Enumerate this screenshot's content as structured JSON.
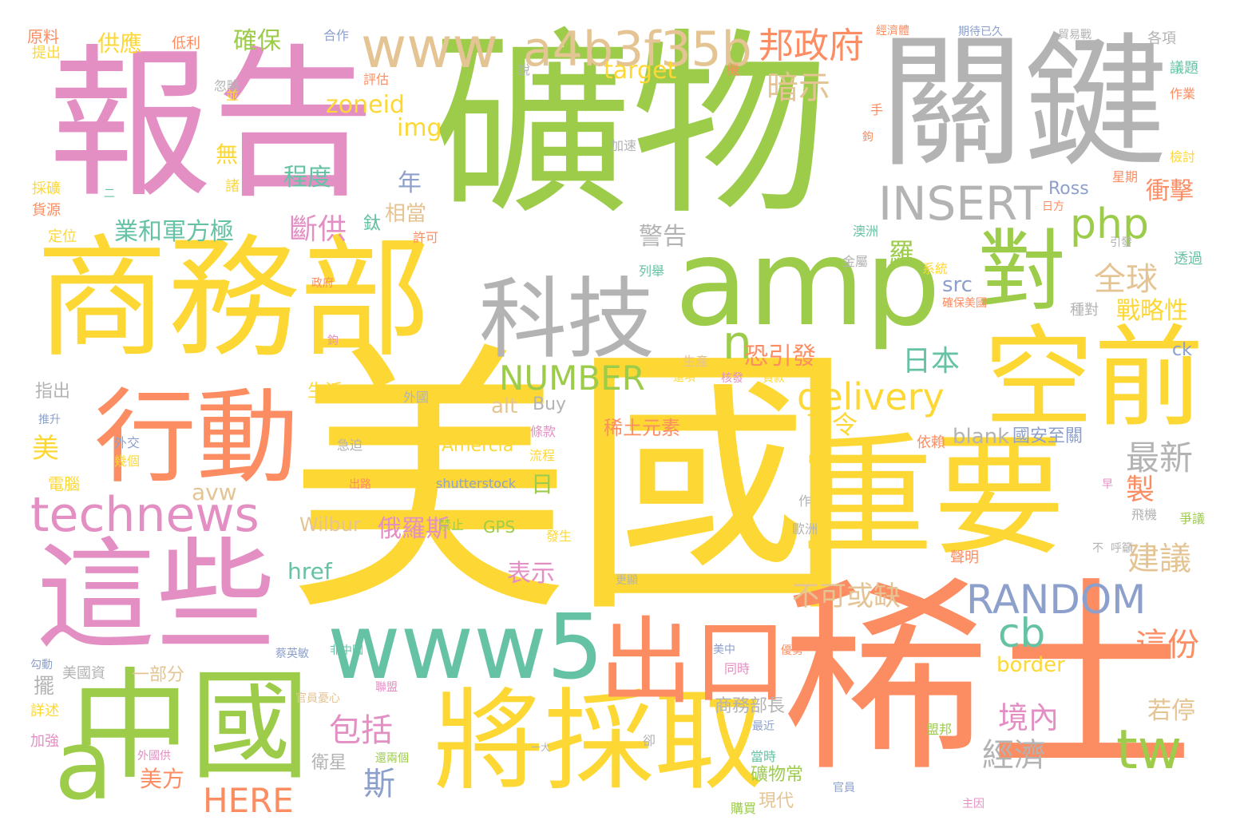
{
  "palette": {
    "yellow": "#fdd835",
    "green": "#9ccc4a",
    "pink": "#e48fc4",
    "gray": "#b3b3b3",
    "orange": "#fc8d62",
    "teal": "#66c2a5",
    "blue": "#8da0cb",
    "tan": "#e5c494"
  },
  "words": [
    {
      "text": "美國",
      "color": "yellow"
    },
    {
      "text": "礦物",
      "color": "green"
    },
    {
      "text": "稀土",
      "color": "orange"
    },
    {
      "text": "報告",
      "color": "pink"
    },
    {
      "text": "關鍵",
      "color": "gray"
    },
    {
      "text": "商務部",
      "color": "yellow"
    },
    {
      "text": "重要",
      "color": "yellow"
    },
    {
      "text": "amp",
      "color": "green"
    },
    {
      "text": "行動",
      "color": "orange"
    },
    {
      "text": "這些",
      "color": "pink"
    },
    {
      "text": "中國",
      "color": "green"
    },
    {
      "text": "將採取",
      "color": "yellow"
    },
    {
      "text": "空前",
      "color": "yellow"
    },
    {
      "text": "科技",
      "color": "gray"
    },
    {
      "text": "www5",
      "color": "teal"
    },
    {
      "text": "出口",
      "color": "orange"
    },
    {
      "text": "對",
      "color": "green"
    },
    {
      "text": "www",
      "color": "tan"
    },
    {
      "text": "a4b3f35b",
      "color": "tan"
    },
    {
      "text": "technews",
      "color": "pink"
    },
    {
      "text": "a",
      "color": "green"
    },
    {
      "text": "INSERT",
      "color": "gray"
    },
    {
      "text": "RANDOM",
      "color": "blue"
    },
    {
      "text": "delivery",
      "color": "yellow"
    },
    {
      "text": "php",
      "color": "green"
    },
    {
      "text": "tw",
      "color": "green"
    },
    {
      "text": "NUMBER",
      "color": "green"
    },
    {
      "text": "邦政府",
      "color": "orange"
    },
    {
      "text": "cb",
      "color": "teal"
    },
    {
      "text": "HERE",
      "color": "orange"
    },
    {
      "text": "n",
      "color": "green"
    },
    {
      "text": "暗示",
      "color": "tan"
    },
    {
      "text": "全球",
      "color": "tan"
    },
    {
      "text": "最新",
      "color": "gray"
    },
    {
      "text": "建議",
      "color": "tan"
    },
    {
      "text": "這份",
      "color": "orange"
    },
    {
      "text": "包括",
      "color": "pink"
    },
    {
      "text": "經濟",
      "color": "gray"
    },
    {
      "text": "境內",
      "color": "pink"
    },
    {
      "text": "不可或缺",
      "color": "tan"
    },
    {
      "text": "日本",
      "color": "teal"
    },
    {
      "text": "斷供",
      "color": "pink"
    },
    {
      "text": "業和軍方極",
      "color": "teal"
    },
    {
      "text": "zoneid",
      "color": "yellow"
    },
    {
      "text": "target",
      "color": "yellow"
    },
    {
      "text": "img",
      "color": "yellow"
    },
    {
      "text": "程度",
      "color": "teal"
    },
    {
      "text": "確保",
      "color": "green"
    },
    {
      "text": "戰略性",
      "color": "yellow"
    },
    {
      "text": "恐引發",
      "color": "orange"
    },
    {
      "text": "警告",
      "color": "gray"
    },
    {
      "text": "衝擊",
      "color": "orange"
    },
    {
      "text": "供應",
      "color": "yellow"
    },
    {
      "text": "年",
      "color": "blue"
    },
    {
      "text": "相當",
      "color": "tan"
    },
    {
      "text": "羅",
      "color": "green"
    },
    {
      "text": "src",
      "color": "blue"
    },
    {
      "text": "俄羅斯",
      "color": "pink"
    },
    {
      "text": "表示",
      "color": "pink"
    },
    {
      "text": "blank",
      "color": "gray"
    },
    {
      "text": "國安至關",
      "color": "blue"
    },
    {
      "text": "border",
      "color": "yellow"
    },
    {
      "text": "avw",
      "color": "tan"
    },
    {
      "text": "Wilbur",
      "color": "tan"
    },
    {
      "text": "href",
      "color": "teal"
    },
    {
      "text": "alt",
      "color": "tan"
    },
    {
      "text": "Buy",
      "color": "gray"
    },
    {
      "text": "稀土元素",
      "color": "orange"
    },
    {
      "text": "Amercia",
      "color": "yellow"
    },
    {
      "text": "shutterstock",
      "color": "blue"
    },
    {
      "text": "GPS",
      "color": "green"
    },
    {
      "text": "Ross",
      "color": "blue"
    },
    {
      "text": "ck",
      "color": "blue"
    },
    {
      "text": "美",
      "color": "yellow"
    },
    {
      "text": "斯",
      "color": "blue"
    },
    {
      "text": "美方",
      "color": "orange"
    },
    {
      "text": "生活",
      "color": "yellow"
    },
    {
      "text": "指出",
      "color": "gray"
    },
    {
      "text": "若停",
      "color": "tan"
    },
    {
      "text": "製",
      "color": "orange"
    },
    {
      "text": "下令",
      "color": "yellow"
    },
    {
      "text": "日",
      "color": "green"
    },
    {
      "text": "無",
      "color": "yellow"
    },
    {
      "text": "商務部長",
      "color": "gray"
    },
    {
      "text": "衛星",
      "color": "gray"
    },
    {
      "text": "礦物常",
      "color": "green"
    },
    {
      "text": "現代",
      "color": "tan"
    },
    {
      "text": "擺",
      "color": "gray"
    },
    {
      "text": "一部分",
      "color": "tan"
    },
    {
      "text": "美國資",
      "color": "gray"
    },
    {
      "text": "原料",
      "color": "orange"
    },
    {
      "text": "提出",
      "color": "yellow"
    },
    {
      "text": "低利",
      "color": "orange"
    },
    {
      "text": "合作",
      "color": "blue"
    },
    {
      "text": "評估",
      "color": "orange"
    },
    {
      "text": "忽略",
      "color": "gray"
    },
    {
      "text": "加速",
      "color": "gray"
    },
    {
      "text": "種對",
      "color": "gray"
    },
    {
      "text": "透過",
      "color": "teal"
    },
    {
      "text": "經濟體",
      "color": "orange"
    },
    {
      "text": "期待已久",
      "color": "blue"
    },
    {
      "text": "貿易戰",
      "color": "gray"
    },
    {
      "text": "各項",
      "color": "gray"
    },
    {
      "text": "議題",
      "color": "teal"
    },
    {
      "text": "作業",
      "color": "orange"
    },
    {
      "text": "檢討",
      "color": "yellow"
    },
    {
      "text": "星期",
      "color": "orange"
    },
    {
      "text": "日方",
      "color": "orange"
    },
    {
      "text": "引發",
      "color": "gray"
    },
    {
      "text": "系統",
      "color": "yellow"
    },
    {
      "text": "澳洲",
      "color": "teal"
    },
    {
      "text": "許可",
      "color": "orange"
    },
    {
      "text": "鈦",
      "color": "teal"
    },
    {
      "text": "諸",
      "color": "yellow"
    },
    {
      "text": "金屬",
      "color": "gray"
    },
    {
      "text": "列舉",
      "color": "teal"
    },
    {
      "text": "政府",
      "color": "orange"
    },
    {
      "text": "確保美國",
      "color": "orange"
    },
    {
      "text": "電腦",
      "color": "yellow"
    },
    {
      "text": "依賴",
      "color": "orange"
    },
    {
      "text": "條款",
      "color": "pink"
    },
    {
      "text": "流程",
      "color": "yellow"
    },
    {
      "text": "禁止",
      "color": "green"
    },
    {
      "text": "更顯",
      "color": "gray"
    },
    {
      "text": "作",
      "color": "gray"
    },
    {
      "text": "歐洲",
      "color": "gray"
    },
    {
      "text": "聲明",
      "color": "orange"
    },
    {
      "text": "不",
      "color": "gray"
    },
    {
      "text": "同時",
      "color": "pink"
    },
    {
      "text": "美中",
      "color": "blue"
    },
    {
      "text": "優勢",
      "color": "orange"
    },
    {
      "text": "最近",
      "color": "blue"
    },
    {
      "text": "當時",
      "color": "teal"
    },
    {
      "text": "官員",
      "color": "blue"
    },
    {
      "text": "購買",
      "color": "green"
    },
    {
      "text": "盟邦",
      "color": "green"
    },
    {
      "text": "卻",
      "color": "gray"
    },
    {
      "text": "官員憂心",
      "color": "tan"
    },
    {
      "text": "聯盟",
      "color": "pink"
    },
    {
      "text": "詳述",
      "color": "yellow"
    },
    {
      "text": "加強",
      "color": "pink"
    },
    {
      "text": "定位",
      "color": "yellow"
    },
    {
      "text": "貨源",
      "color": "orange"
    },
    {
      "text": "採礦",
      "color": "yellow"
    },
    {
      "text": "推升",
      "color": "blue"
    },
    {
      "text": "外交",
      "color": "blue"
    },
    {
      "text": "幾個",
      "color": "yellow"
    },
    {
      "text": "急迫",
      "color": "gray"
    },
    {
      "text": "外國",
      "color": "gray"
    },
    {
      "text": "生產",
      "color": "tan"
    },
    {
      "text": "貸款",
      "color": "yellow"
    },
    {
      "text": "發生",
      "color": "yellow"
    },
    {
      "text": "飛機",
      "color": "gray"
    },
    {
      "text": "爭議",
      "color": "green"
    },
    {
      "text": "呼籲",
      "color": "gray"
    },
    {
      "text": "早",
      "color": "pink"
    },
    {
      "text": "鉤",
      "color": "pink"
    },
    {
      "text": "核發",
      "color": "pink"
    },
    {
      "text": "還項",
      "color": "yellow"
    },
    {
      "text": "手",
      "color": "orange"
    },
    {
      "text": "機",
      "color": "orange"
    },
    {
      "text": "並",
      "color": "yellow"
    },
    {
      "text": "說",
      "color": "gray"
    },
    {
      "text": "二",
      "color": "teal"
    },
    {
      "text": "蔡英敏",
      "color": "blue"
    },
    {
      "text": "非中國",
      "color": "teal"
    },
    {
      "text": "分居",
      "color": "yellow"
    },
    {
      "text": "出路",
      "color": "orange"
    },
    {
      "text": "鉤",
      "color": "orange"
    },
    {
      "text": "勾動",
      "color": "blue"
    },
    {
      "text": "外國供",
      "color": "pink"
    },
    {
      "text": "還兩個",
      "color": "green"
    },
    {
      "text": "一大",
      "color": "gray"
    },
    {
      "text": "主因",
      "color": "pink"
    }
  ]
}
